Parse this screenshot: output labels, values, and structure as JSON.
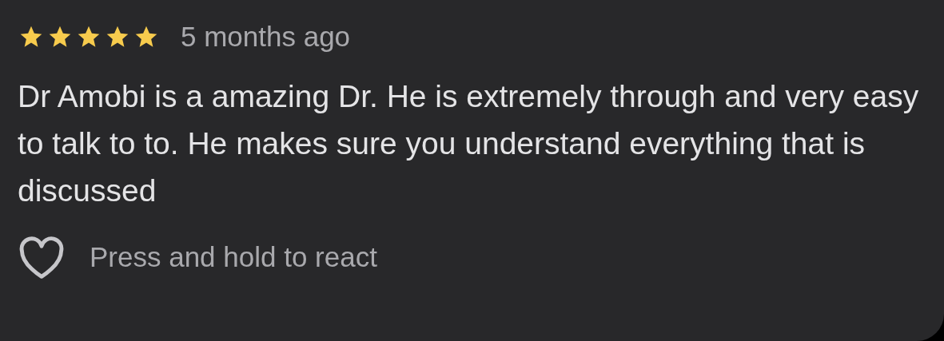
{
  "review": {
    "stars": 5,
    "time": "5 months ago",
    "text": "Dr Amobi is a amazing Dr. He is extremely through and very easy to talk to to. He makes sure you understand everything that is discussed",
    "liked": false,
    "react_hint": "Press and hold to react"
  }
}
